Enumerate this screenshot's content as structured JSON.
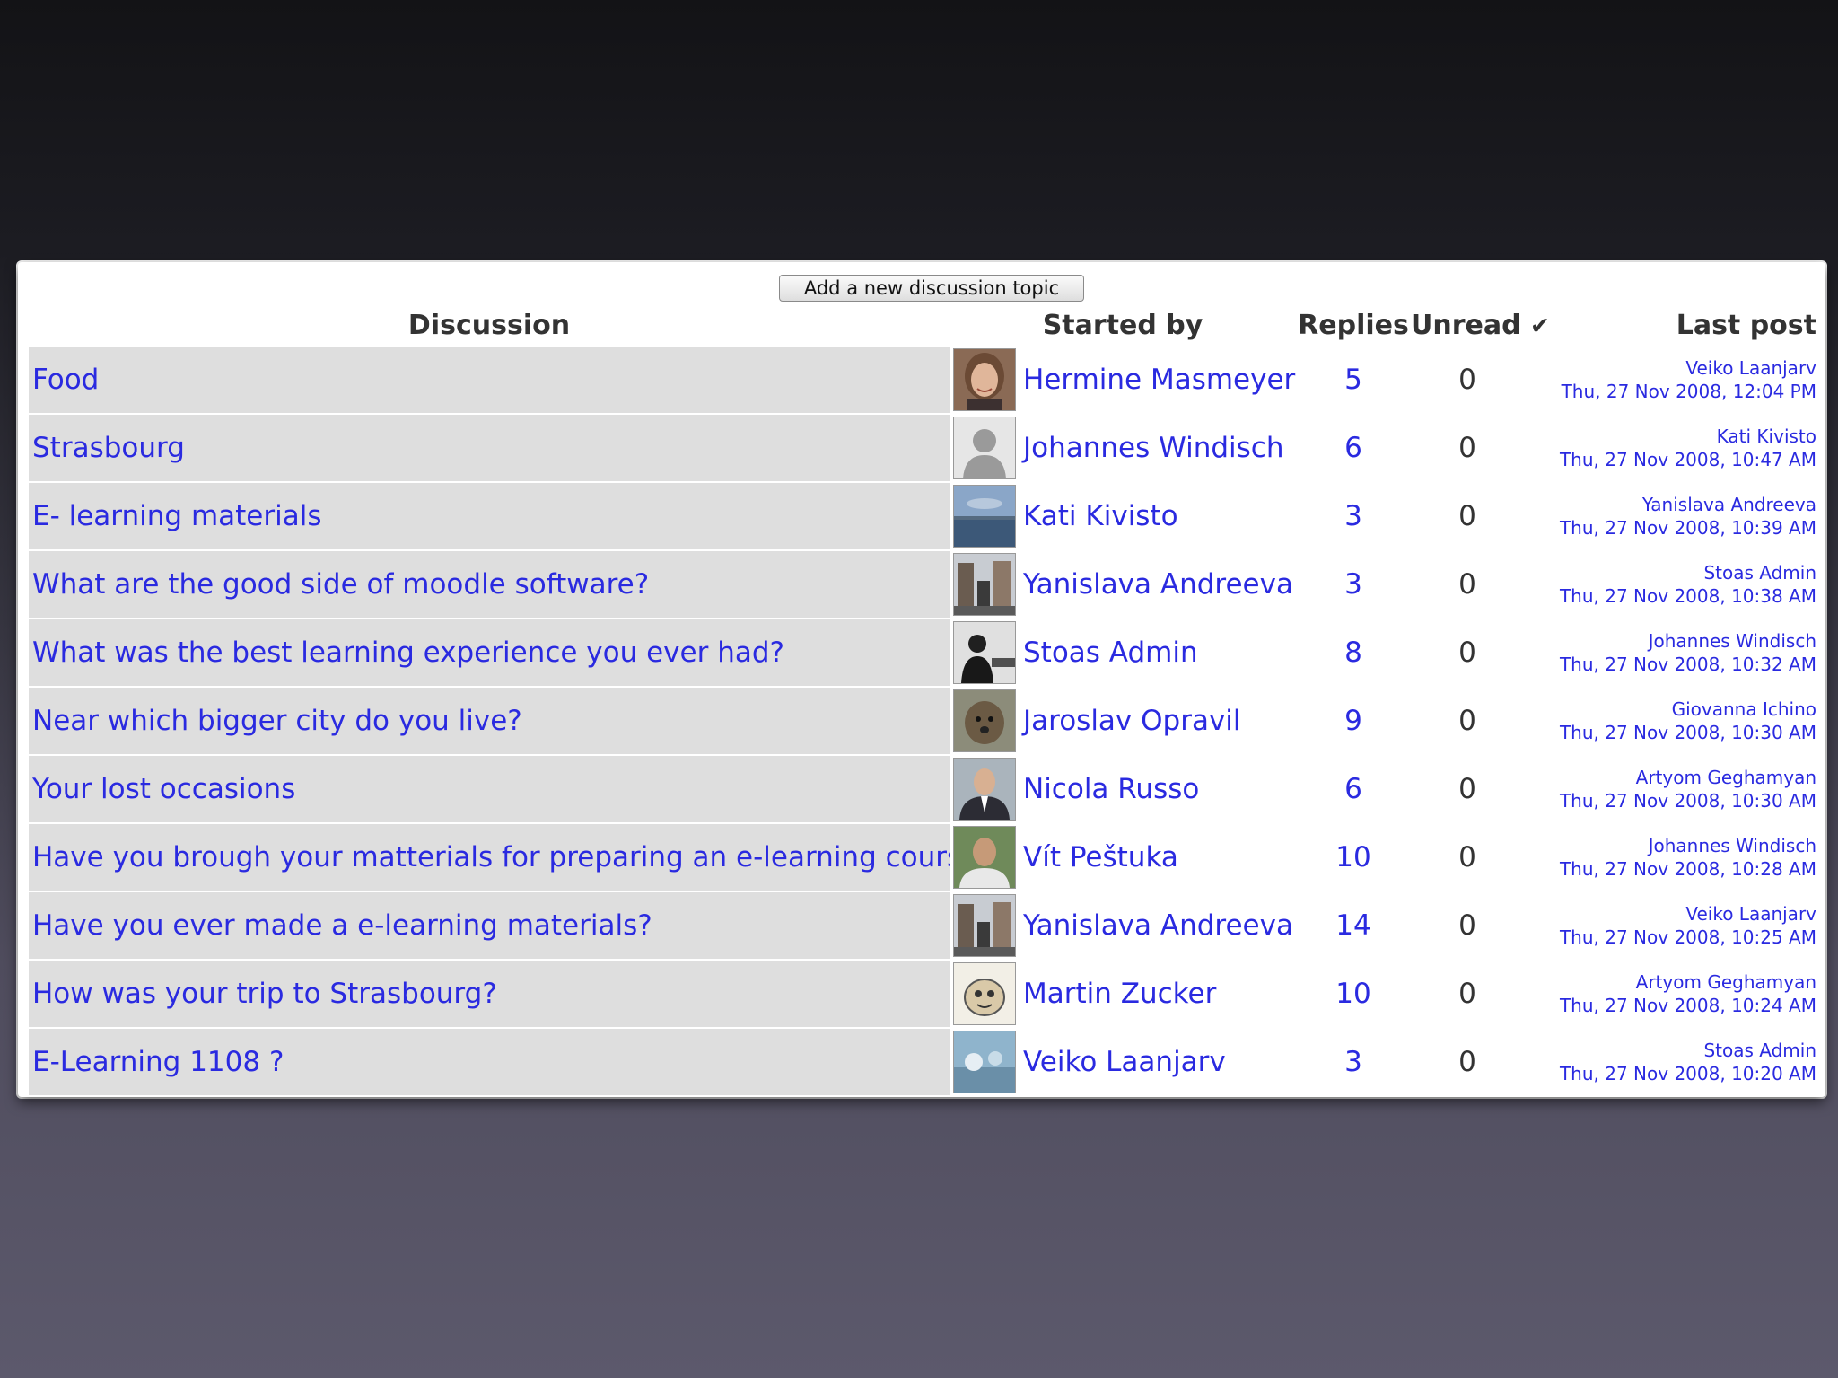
{
  "add_button_label": "Add a new discussion topic",
  "headers": {
    "discussion": "Discussion",
    "started_by": "Started by",
    "replies": "Replies",
    "unread": "Unread",
    "unread_icon": "✔",
    "last_post": "Last post"
  },
  "colors": {
    "link": "#2a2ae0",
    "row_topic_bg": "#dedede"
  },
  "rows": [
    {
      "topic": "Food",
      "author": "Hermine Masmeyer",
      "replies": "5",
      "unread": "0",
      "last_user": "Veiko Laanjarv",
      "last_date": "Thu, 27 Nov 2008, 12:04 PM",
      "avatar": "woman-portrait"
    },
    {
      "topic": "Strasbourg",
      "author": "Johannes Windisch",
      "replies": "6",
      "unread": "0",
      "last_user": "Kati Kivisto",
      "last_date": "Thu, 27 Nov 2008, 10:47 AM",
      "avatar": "default-silhouette"
    },
    {
      "topic": "E- learning materials",
      "author": "Kati Kivisto",
      "replies": "3",
      "unread": "0",
      "last_user": "Yanislava Andreeva",
      "last_date": "Thu, 27 Nov 2008, 10:39 AM",
      "avatar": "seascape"
    },
    {
      "topic": "What are the good side of moodle software?",
      "author": "Yanislava Andreeva",
      "replies": "3",
      "unread": "0",
      "last_user": "Stoas Admin",
      "last_date": "Thu, 27 Nov 2008, 10:38 AM",
      "avatar": "street-scene"
    },
    {
      "topic": "What was the best learning experience you ever had?",
      "author": "Stoas Admin",
      "replies": "8",
      "unread": "0",
      "last_user": "Johannes Windisch",
      "last_date": "Thu, 27 Nov 2008, 10:32 AM",
      "avatar": "bw-speaker"
    },
    {
      "topic": "Near which bigger city do you live?",
      "author": "Jaroslav Opravil",
      "replies": "9",
      "unread": "0",
      "last_user": "Giovanna Ichino",
      "last_date": "Thu, 27 Nov 2008, 10:30 AM",
      "avatar": "dog"
    },
    {
      "topic": "Your lost occasions",
      "author": "Nicola Russo",
      "replies": "6",
      "unread": "0",
      "last_user": "Artyom Geghamyan",
      "last_date": "Thu, 27 Nov 2008, 10:30 AM",
      "avatar": "man-suit"
    },
    {
      "topic": "Have you brough your matterials for preparing an e-learning course?",
      "author": "Vít Peštuka",
      "replies": "10",
      "unread": "0",
      "last_user": "Johannes Windisch",
      "last_date": "Thu, 27 Nov 2008, 10:28 AM",
      "avatar": "man-outdoor"
    },
    {
      "topic": "Have you ever made a e-learning materials?",
      "author": "Yanislava Andreeva",
      "replies": "14",
      "unread": "0",
      "last_user": "Veiko Laanjarv",
      "last_date": "Thu, 27 Nov 2008, 10:25 AM",
      "avatar": "street-scene"
    },
    {
      "topic": "How was your trip to Strasbourg?",
      "author": "Martin Zucker",
      "replies": "10",
      "unread": "0",
      "last_user": "Artyom Geghamyan",
      "last_date": "Thu, 27 Nov 2008, 10:24 AM",
      "avatar": "cartoon"
    },
    {
      "topic": "E-Learning 1108 ?",
      "author": "Veiko Laanjarv",
      "replies": "3",
      "unread": "0",
      "last_user": "Stoas Admin",
      "last_date": "Thu, 27 Nov 2008, 10:20 AM",
      "avatar": "painting"
    }
  ]
}
